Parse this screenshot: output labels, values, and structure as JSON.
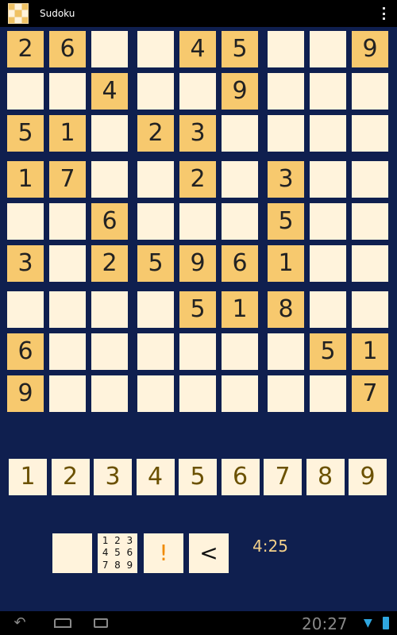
{
  "app": {
    "title": "Sudoku"
  },
  "grid": {
    "rows": [
      [
        "2",
        "6",
        "",
        "",
        "4",
        "5",
        "",
        "",
        "9"
      ],
      [
        "",
        "",
        "4",
        "",
        "",
        "9",
        "",
        "",
        ""
      ],
      [
        "5",
        "1",
        "",
        "2",
        "3",
        "",
        "",
        "",
        ""
      ],
      [
        "1",
        "7",
        "",
        "",
        "2",
        "",
        "3",
        "",
        ""
      ],
      [
        "",
        "",
        "6",
        "",
        "",
        "",
        "5",
        "",
        ""
      ],
      [
        "3",
        "",
        "2",
        "5",
        "9",
        "6",
        "1",
        "",
        ""
      ],
      [
        "",
        "",
        "",
        "",
        "5",
        "1",
        "8",
        "",
        ""
      ],
      [
        "6",
        "",
        "",
        "",
        "",
        "",
        "",
        "5",
        "1"
      ],
      [
        "9",
        "",
        "",
        "",
        "",
        "",
        "",
        "",
        "7"
      ]
    ],
    "given_cells": [
      [
        0,
        0
      ],
      [
        0,
        1
      ],
      [
        0,
        4
      ],
      [
        0,
        5
      ],
      [
        0,
        8
      ],
      [
        1,
        2
      ],
      [
        1,
        5
      ],
      [
        2,
        0
      ],
      [
        2,
        1
      ],
      [
        2,
        3
      ],
      [
        2,
        4
      ],
      [
        3,
        0
      ],
      [
        3,
        1
      ],
      [
        3,
        4
      ],
      [
        3,
        6
      ],
      [
        4,
        2
      ],
      [
        4,
        6
      ],
      [
        5,
        0
      ],
      [
        5,
        2
      ],
      [
        5,
        3
      ],
      [
        5,
        4
      ],
      [
        5,
        5
      ],
      [
        5,
        6
      ],
      [
        6,
        4
      ],
      [
        6,
        5
      ],
      [
        6,
        6
      ],
      [
        7,
        0
      ],
      [
        7,
        7
      ],
      [
        7,
        8
      ],
      [
        8,
        0
      ],
      [
        8,
        8
      ]
    ]
  },
  "numpad": [
    "1",
    "2",
    "3",
    "4",
    "5",
    "6",
    "7",
    "8",
    "9"
  ],
  "tools": {
    "notes_digits": [
      "1",
      "2",
      "3",
      "4",
      "5",
      "6",
      "7",
      "8",
      "9"
    ],
    "hint_label": "!",
    "undo_label": "<"
  },
  "timer": "4:25",
  "status": {
    "clock": "20:27"
  },
  "colors": {
    "background": "#0f1f4f",
    "given_cell": "#f7c96e",
    "empty_cell": "#fff3dc",
    "hint": "#f08a00",
    "timer_text": "#f3d08a"
  },
  "icons": {
    "overflow": "overflow-menu-icon",
    "back": "back-icon",
    "home": "home-icon",
    "recents": "recent-apps-icon",
    "wifi": "wifi-icon",
    "battery": "battery-icon"
  }
}
